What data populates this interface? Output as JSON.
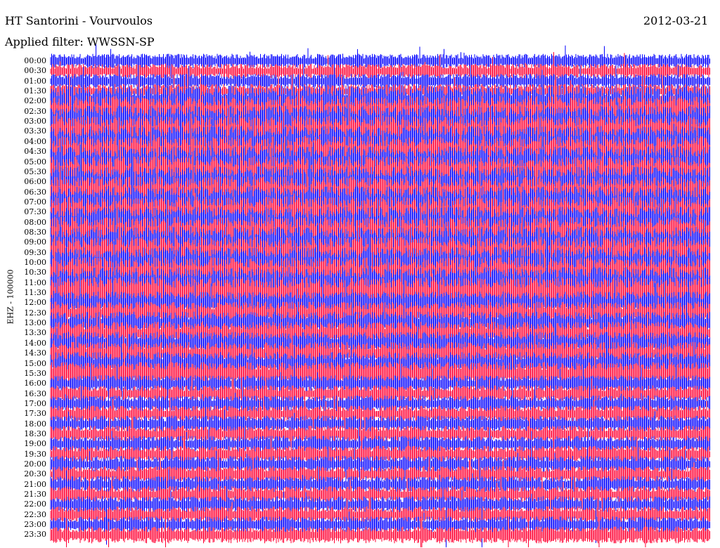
{
  "header": {
    "title": "HT Santorini - Vourvoulos",
    "subtitle": "Applied filter: WWSSN-SP",
    "date": "2012-03-21"
  },
  "chart_data": {
    "type": "line",
    "ylabel": "EHZ - 100000",
    "row_labels": [
      "00:00",
      "00:30",
      "01:00",
      "01:30",
      "02:00",
      "02:30",
      "03:00",
      "03:30",
      "04:00",
      "04:30",
      "05:00",
      "05:30",
      "06:00",
      "06:30",
      "07:00",
      "07:30",
      "08:00",
      "08:30",
      "09:00",
      "09:30",
      "10:00",
      "10:30",
      "11:00",
      "11:30",
      "12:00",
      "12:30",
      "13:00",
      "13:30",
      "14:00",
      "14:30",
      "15:00",
      "15:30",
      "16:00",
      "16:30",
      "17:00",
      "17:30",
      "18:00",
      "18:30",
      "19:00",
      "19:30",
      "20:00",
      "20:30",
      "21:00",
      "21:30",
      "22:00",
      "22:30",
      "23:00",
      "23:30"
    ],
    "series": [
      {
        "color": "#0000ff"
      },
      {
        "color": "#ff0033"
      }
    ],
    "grid": false,
    "legend": "none"
  }
}
